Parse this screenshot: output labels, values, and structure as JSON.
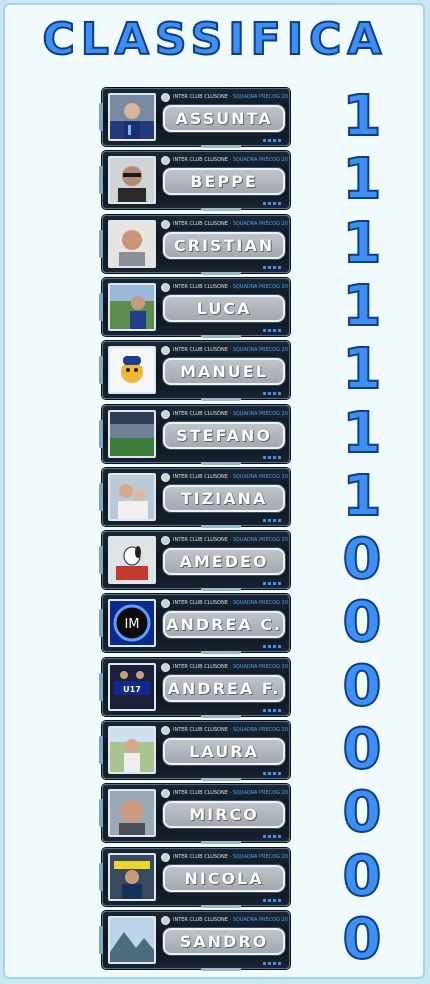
{
  "title": "CLASSIFICA",
  "header": {
    "club": "INTER CLUB CLUSONE",
    "separator": "·",
    "team": "SQUADRA PRECOG 2026/27"
  },
  "colors": {
    "accent": "#3f8ff0",
    "outline": "#0d3c8c",
    "card": "#0c141e",
    "nameplate": "#a9afb5"
  },
  "entries": [
    {
      "name": "ASSUNTA",
      "score": "1",
      "avatar": "woman-in-inter-shirt-photo"
    },
    {
      "name": "BEPPE",
      "score": "1",
      "avatar": "man-with-sunglasses-photo"
    },
    {
      "name": "CRISTIAN",
      "score": "1",
      "avatar": "bald-man-photo"
    },
    {
      "name": "LUCA",
      "score": "1",
      "avatar": "man-at-stadium-photo"
    },
    {
      "name": "MANUEL",
      "score": "1",
      "avatar": "mascot-figure-icon"
    },
    {
      "name": "STEFANO",
      "score": "1",
      "avatar": "stadium-photo"
    },
    {
      "name": "TIZIANA",
      "score": "1",
      "avatar": "woman-with-child-photo"
    },
    {
      "name": "AMEDEO",
      "score": "0",
      "avatar": "snoopy-icon"
    },
    {
      "name": "ANDREA C.",
      "score": "0",
      "avatar": "inter-logo-icon"
    },
    {
      "name": "ANDREA F.",
      "score": "0",
      "avatar": "under-17-badge-icon"
    },
    {
      "name": "LAURA",
      "score": "0",
      "avatar": "woman-outdoors-photo"
    },
    {
      "name": "MIRCO",
      "score": "0",
      "avatar": "smiling-man-photo"
    },
    {
      "name": "NICOLA",
      "score": "0",
      "avatar": "man-with-scarf-photo"
    },
    {
      "name": "SANDRO",
      "score": "0",
      "avatar": "mountain-landscape-photo"
    }
  ]
}
